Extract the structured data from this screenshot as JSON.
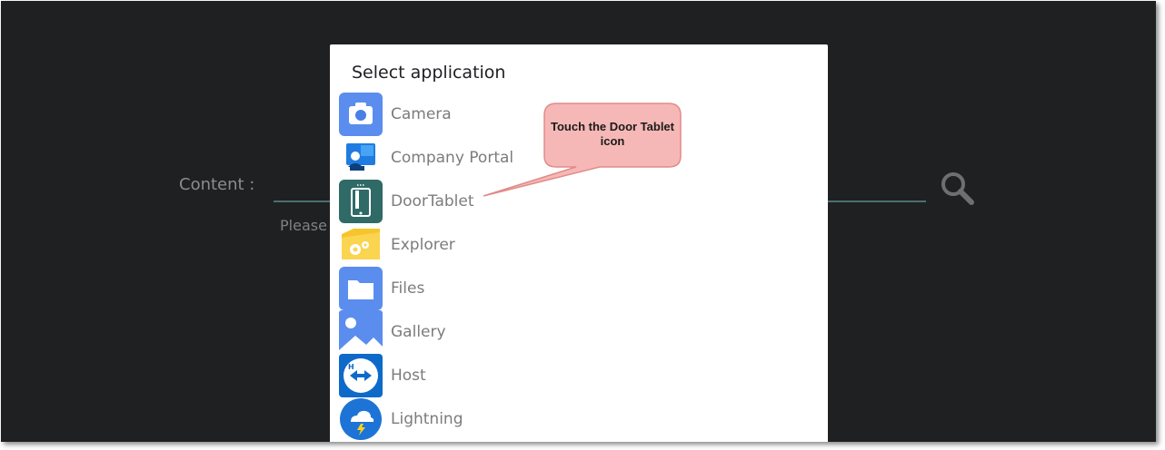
{
  "background_screen": {
    "content_label": "Content :",
    "hint_text": "Please",
    "search_icon": "search-icon"
  },
  "dialog": {
    "title": "Select application",
    "apps": [
      {
        "label": "Camera",
        "icon": "camera-icon"
      },
      {
        "label": "Company Portal",
        "icon": "company-portal-icon"
      },
      {
        "label": "DoorTablet",
        "icon": "doortablet-icon"
      },
      {
        "label": "Explorer",
        "icon": "explorer-icon"
      },
      {
        "label": "Files",
        "icon": "files-icon"
      },
      {
        "label": "Gallery",
        "icon": "gallery-icon"
      },
      {
        "label": "Host",
        "icon": "host-icon"
      },
      {
        "label": "Lightning",
        "icon": "lightning-icon"
      }
    ]
  },
  "callout": {
    "text": "Touch the Door Tablet icon"
  },
  "colors": {
    "screen_bg": "#1e2022",
    "underline": "#4c6f73",
    "callout_fill": "#f4b3b3",
    "callout_border": "#e48a8a"
  }
}
